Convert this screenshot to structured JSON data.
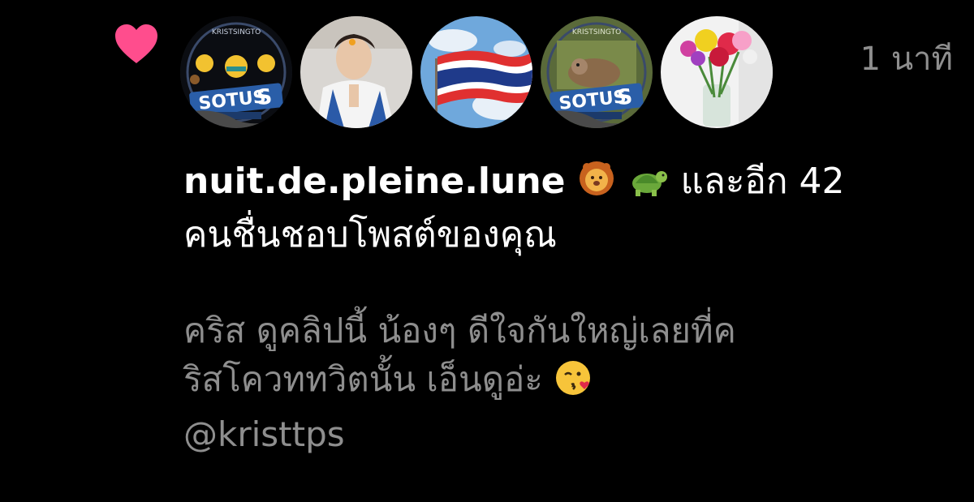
{
  "notification": {
    "timestamp": "1 นาที",
    "liker_username": "nuit.de.pleine.lune",
    "liker_emojis": [
      "lion-emoji",
      "turtle-emoji"
    ],
    "others_text": "และอีก 42",
    "likes_text": "คนชื่นชอบโพสต์ของคุณ",
    "avatars": [
      {
        "name": "avatar-sotus-planets"
      },
      {
        "name": "avatar-person-white-jacket"
      },
      {
        "name": "avatar-thai-flag"
      },
      {
        "name": "avatar-sotus-sloth"
      },
      {
        "name": "avatar-flower-vase"
      }
    ]
  },
  "comment": {
    "text_line1": "คริส ดูคลิปนี้ น้องๆ ดีใจกันใหญ่เลยที่ค",
    "text_line2": "ริสโควททวิตนั้น เอ็นดูอ่ะ",
    "emoji": "kiss-emoji",
    "mention": "@kristtps"
  },
  "colors": {
    "background": "#000000",
    "heart": "#ff4d8d",
    "primary_text": "#ffffff",
    "secondary_text": "#8e8e8e"
  }
}
